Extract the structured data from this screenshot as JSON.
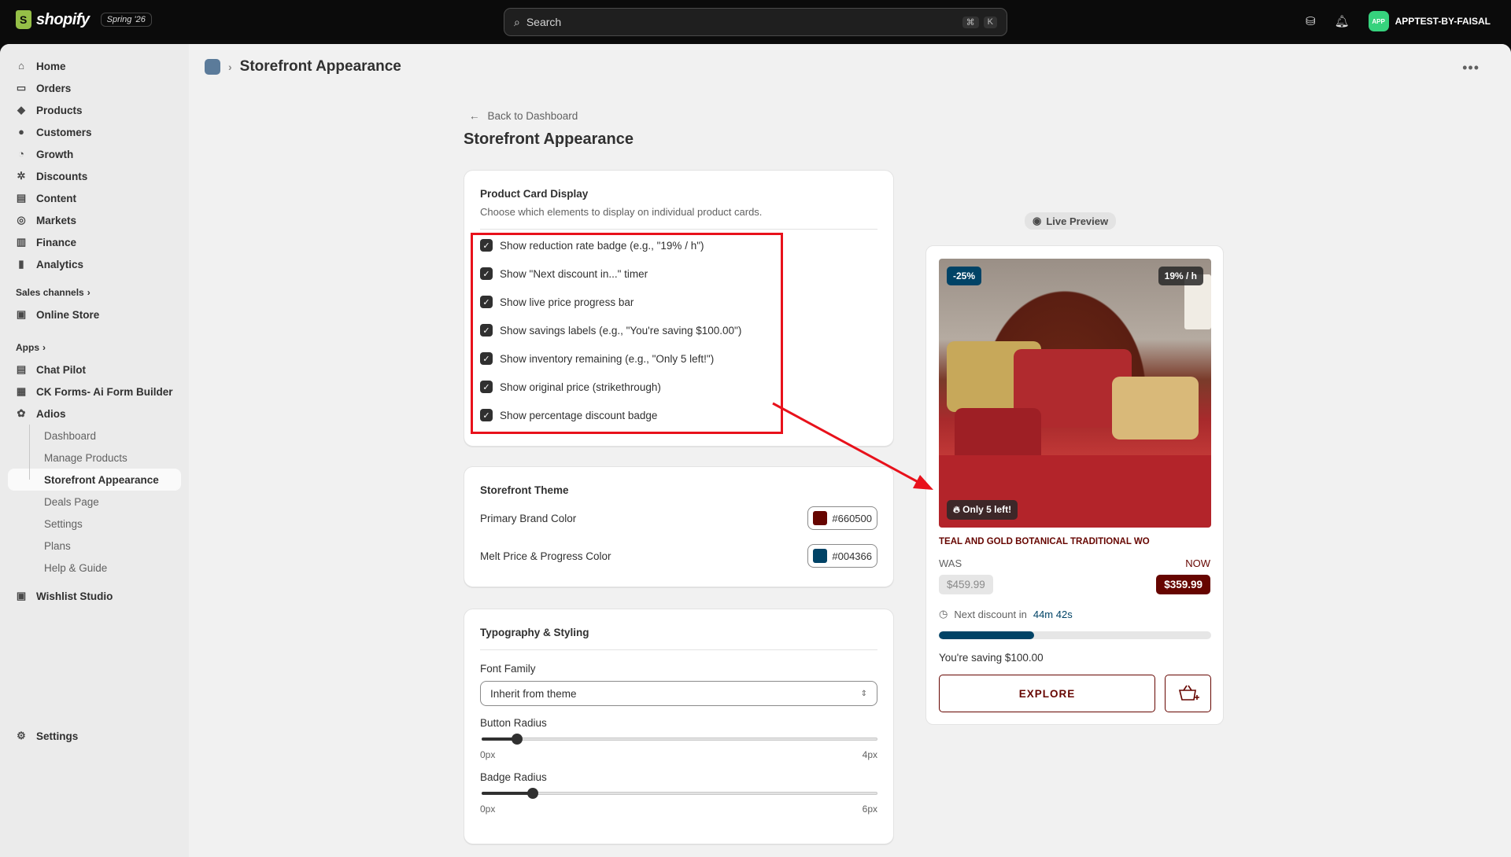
{
  "topbar": {
    "brand": "shopify",
    "season": "Spring '26",
    "search_placeholder": "Search",
    "shortcut_1": "⌘",
    "shortcut_2": "K",
    "store_avatar": "APP",
    "store_name": "APPTEST-BY-FAISAL"
  },
  "sidebar": {
    "items": [
      {
        "label": "Home",
        "icon": "home-icon"
      },
      {
        "label": "Orders",
        "icon": "orders-icon"
      },
      {
        "label": "Products",
        "icon": "tag-icon"
      },
      {
        "label": "Customers",
        "icon": "person-icon"
      },
      {
        "label": "Growth",
        "icon": "gauge-icon"
      },
      {
        "label": "Discounts",
        "icon": "discount-icon"
      },
      {
        "label": "Content",
        "icon": "content-icon"
      },
      {
        "label": "Markets",
        "icon": "globe-icon"
      },
      {
        "label": "Finance",
        "icon": "bank-icon"
      },
      {
        "label": "Analytics",
        "icon": "chart-icon"
      }
    ],
    "sales_channels_label": "Sales channels",
    "online_store": "Online Store",
    "apps_label": "Apps",
    "apps": [
      "Chat Pilot",
      "CK Forms- Ai Form Builder",
      "Adios"
    ],
    "adios_sub": [
      "Dashboard",
      "Manage Products",
      "Storefront Appearance",
      "Deals Page",
      "Settings",
      "Plans",
      "Help & Guide"
    ],
    "wishlist": "Wishlist Studio",
    "settings": "Settings"
  },
  "header": {
    "breadcrumb_title": "Storefront Appearance"
  },
  "page": {
    "back_label": "Back to Dashboard",
    "title": "Storefront Appearance"
  },
  "product_card_display": {
    "title": "Product Card Display",
    "subtitle": "Choose which elements to display on individual product cards.",
    "options": [
      {
        "label": "Show reduction rate badge (e.g., \"19% / h\")",
        "checked": true
      },
      {
        "label": "Show \"Next discount in...\" timer",
        "checked": true
      },
      {
        "label": "Show live price progress bar",
        "checked": true
      },
      {
        "label": "Show savings labels (e.g., \"You're saving $100.00\")",
        "checked": true
      },
      {
        "label": "Show inventory remaining (e.g., \"Only 5 left!\")",
        "checked": true
      },
      {
        "label": "Show original price (strikethrough)",
        "checked": true
      },
      {
        "label": "Show percentage discount badge",
        "checked": true
      }
    ]
  },
  "theme": {
    "title": "Storefront Theme",
    "primary_label": "Primary Brand Color",
    "primary_value": "#660500",
    "melt_label": "Melt Price & Progress Color",
    "melt_value": "#004366"
  },
  "typography": {
    "title": "Typography & Styling",
    "font_label": "Font Family",
    "font_value": "Inherit from theme",
    "button_radius_label": "Button Radius",
    "button_radius_min": "0px",
    "button_radius_max": "4px",
    "button_radius_value_fraction": 0.09,
    "badge_radius_label": "Badge Radius",
    "badge_radius_min": "0px",
    "badge_radius_max": "6px",
    "badge_radius_value_fraction": 0.13
  },
  "preview": {
    "label": "Live Preview",
    "discount_badge": "-25%",
    "rate_badge": "19% / h",
    "stock_badge": "Only 5 left!",
    "product_title": "TEAL AND GOLD BOTANICAL TRADITIONAL WO",
    "was_label": "WAS",
    "now_label": "NOW",
    "old_price": "$459.99",
    "new_price": "$359.99",
    "next_discount_label": "Next discount in",
    "next_discount_time": "44m 42s",
    "progress_fraction": 0.35,
    "saving_text": "You're saving $100.00",
    "explore_label": "EXPLORE"
  }
}
